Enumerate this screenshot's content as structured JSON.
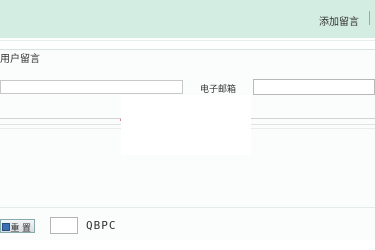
{
  "header": {
    "add_message_link": "添加留言"
  },
  "form": {
    "title": "用户留言",
    "email_label": "电子邮箱",
    "name_value": "",
    "email_value": "",
    "captcha_value": ""
  },
  "actions": {
    "reset_label": "重 置"
  },
  "captcha": {
    "code": "QBPC"
  }
}
